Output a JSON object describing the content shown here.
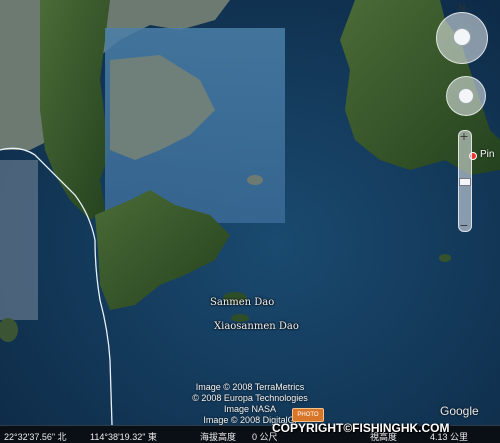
{
  "map": {
    "place_names": {
      "sanmen": "Sanmen Dao",
      "xiaosanmen": "Xiaosanmen Dao",
      "pin": "Pin"
    },
    "credits": [
      "Image © 2008 TerraMetrics",
      "© 2008 Europa Technologies",
      "Image NASA",
      "Image © 2008 DigitalGl"
    ],
    "photo_button": "PHOTO",
    "google_logo": "Google",
    "watermark": "COPYRIGHT©FISHINGHK.COM",
    "status": {
      "latitude": "22°32'37.56\" 北",
      "longitude": "114°38'19.32\" 東",
      "elevation_label": "海拔高度",
      "elevation_value": "0 公尺",
      "right_text": "視高度",
      "right_value": "4.13 公里"
    },
    "nav": {
      "north": "N",
      "zoom_in": "+",
      "zoom_out": "−"
    }
  },
  "colors": {
    "sea": "#123a5c",
    "land": "#2f5a2a",
    "status_bg": "#0a0f16",
    "pin": "#e33333"
  }
}
